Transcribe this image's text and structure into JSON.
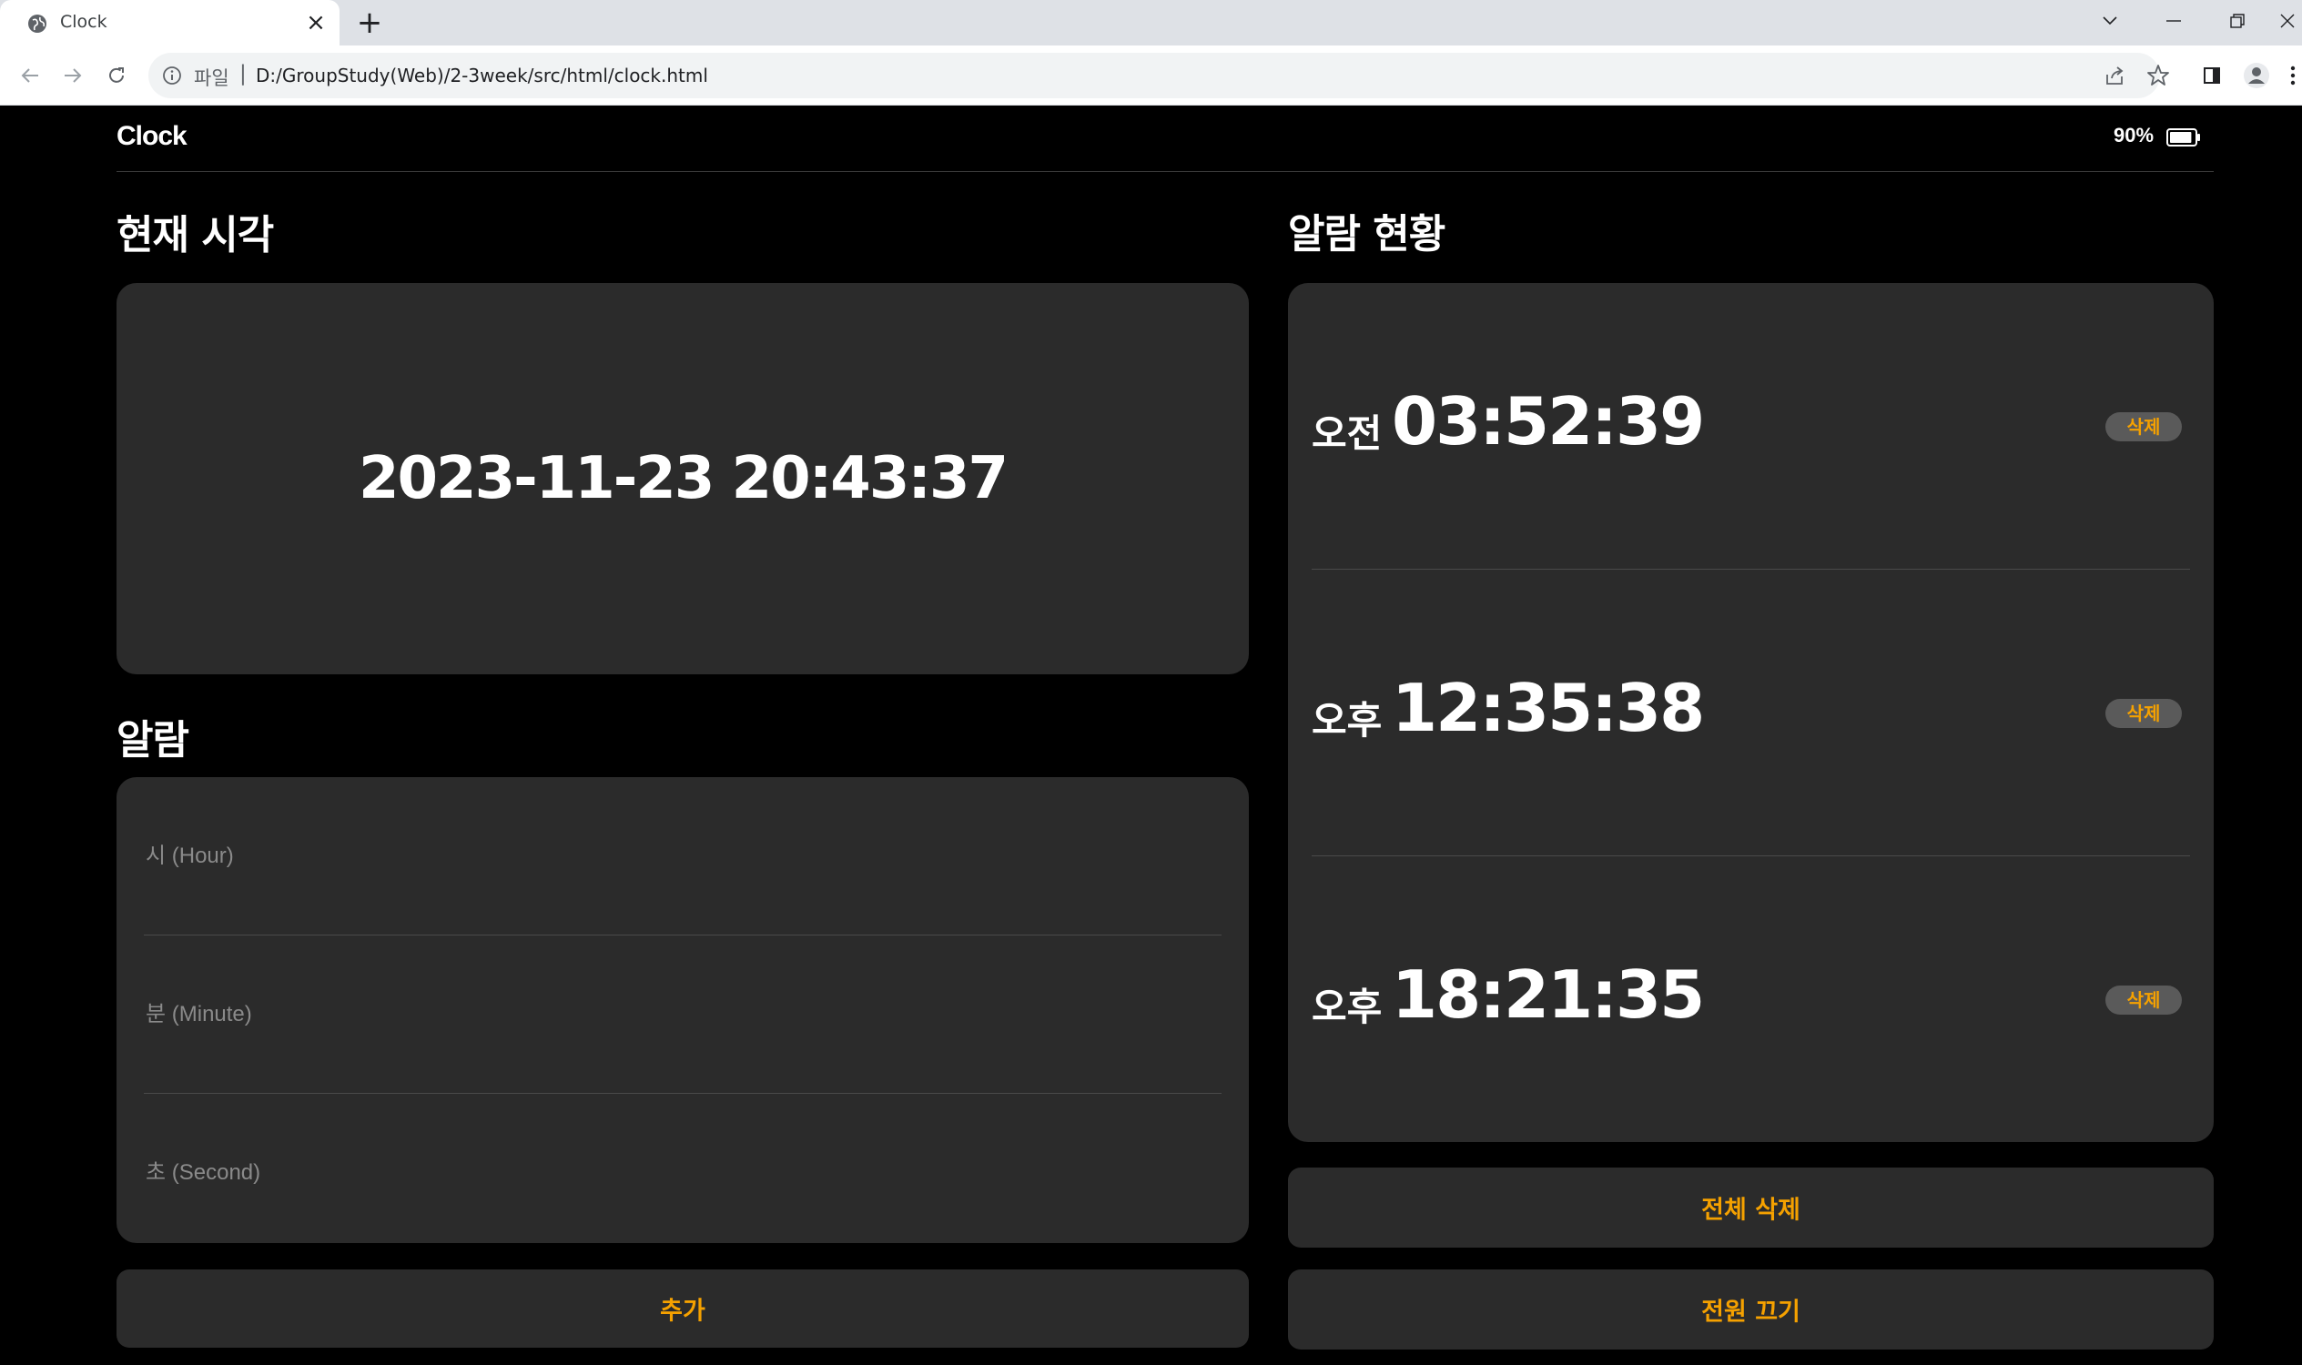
{
  "browser": {
    "tab_title": "Clock",
    "new_tab_label": "+",
    "url_scheme_label": "파일",
    "url_separator": "|",
    "url": "D:/GroupStudy(Web)/2-3week/src/html/clock.html"
  },
  "header": {
    "brand": "Clock",
    "battery_percent": "90%",
    "battery_level": 0.9
  },
  "current_time": {
    "title": "현재 시각",
    "value": "2023-11-23 20:43:37"
  },
  "alarm_form": {
    "title": "알람",
    "hour_placeholder": "시 (Hour)",
    "minute_placeholder": "분 (Minute)",
    "second_placeholder": "초 (Second)",
    "add_button": "추가"
  },
  "alarm_list": {
    "title": "알람 현황",
    "items": [
      {
        "period": "오전",
        "time": "03:52:39",
        "delete_label": "삭제"
      },
      {
        "period": "오후",
        "time": "12:35:38",
        "delete_label": "삭제"
      },
      {
        "period": "오후",
        "time": "18:21:35",
        "delete_label": "삭제"
      }
    ],
    "delete_all_button": "전체 삭제",
    "power_off_button": "전원 끄기"
  },
  "colors": {
    "accent": "#f5a100",
    "card_bg": "#2b2b2b",
    "page_bg": "#000000"
  }
}
